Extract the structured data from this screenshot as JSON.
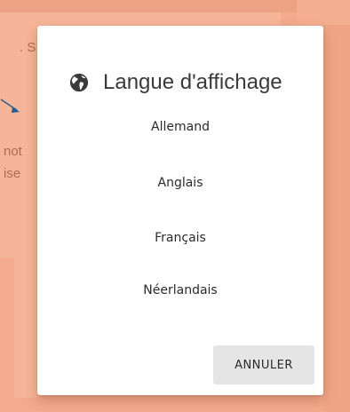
{
  "background": {
    "fragment_1": ". S",
    "fragment_2": "not",
    "fragment_3": "ise"
  },
  "dialog": {
    "icon": "globe-icon",
    "title": "Langue d'affichage",
    "languages": [
      "Allemand",
      "Anglais",
      "Français",
      "Néerlandais"
    ],
    "cancel_label": "ANNULER"
  },
  "colors": {
    "overlay": "#f2ab8d",
    "dialog_background": "#ffffff",
    "cancel_button_background": "#e5e5e5",
    "arrow": "#2a5d8f"
  }
}
